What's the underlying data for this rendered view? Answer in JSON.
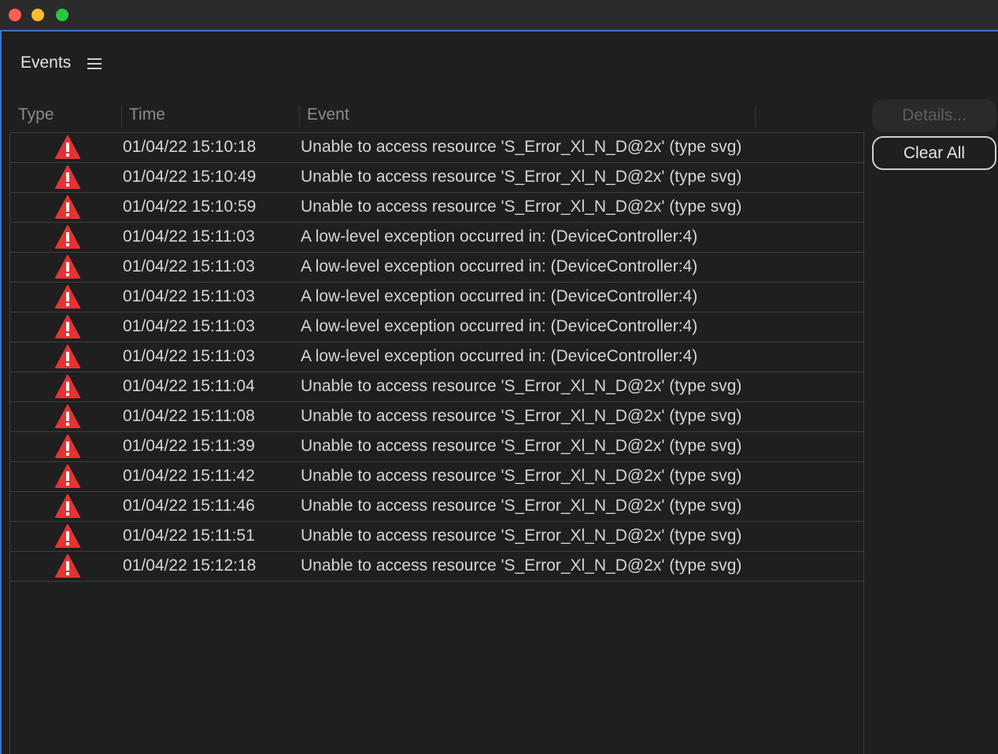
{
  "panel": {
    "title": "Events"
  },
  "columns": {
    "type": "Type",
    "time": "Time",
    "event": "Event"
  },
  "buttons": {
    "details": "Details...",
    "clear_all": "Clear All"
  },
  "colors": {
    "accent": "#3a79c9",
    "warning": "#e63232",
    "close": "#fe5f57",
    "minimize": "#febc2e",
    "maximize": "#28c840"
  },
  "rows": [
    {
      "type_icon": "warning-icon",
      "time": "01/04/22 15:10:18",
      "event": "Unable to access resource 'S_Error_Xl_N_D@2x' (type svg)"
    },
    {
      "type_icon": "warning-icon",
      "time": "01/04/22 15:10:49",
      "event": "Unable to access resource 'S_Error_Xl_N_D@2x' (type svg)"
    },
    {
      "type_icon": "warning-icon",
      "time": "01/04/22 15:10:59",
      "event": "Unable to access resource 'S_Error_Xl_N_D@2x' (type svg)"
    },
    {
      "type_icon": "warning-icon",
      "time": "01/04/22 15:11:03",
      "event": "A low-level exception occurred in:  (DeviceController:4)"
    },
    {
      "type_icon": "warning-icon",
      "time": "01/04/22 15:11:03",
      "event": "A low-level exception occurred in:  (DeviceController:4)"
    },
    {
      "type_icon": "warning-icon",
      "time": "01/04/22 15:11:03",
      "event": "A low-level exception occurred in:  (DeviceController:4)"
    },
    {
      "type_icon": "warning-icon",
      "time": "01/04/22 15:11:03",
      "event": "A low-level exception occurred in:  (DeviceController:4)"
    },
    {
      "type_icon": "warning-icon",
      "time": "01/04/22 15:11:03",
      "event": "A low-level exception occurred in:  (DeviceController:4)"
    },
    {
      "type_icon": "warning-icon",
      "time": "01/04/22 15:11:04",
      "event": "Unable to access resource 'S_Error_Xl_N_D@2x' (type svg)"
    },
    {
      "type_icon": "warning-icon",
      "time": "01/04/22 15:11:08",
      "event": "Unable to access resource 'S_Error_Xl_N_D@2x' (type svg)"
    },
    {
      "type_icon": "warning-icon",
      "time": "01/04/22 15:11:39",
      "event": "Unable to access resource 'S_Error_Xl_N_D@2x' (type svg)"
    },
    {
      "type_icon": "warning-icon",
      "time": "01/04/22 15:11:42",
      "event": "Unable to access resource 'S_Error_Xl_N_D@2x' (type svg)"
    },
    {
      "type_icon": "warning-icon",
      "time": "01/04/22 15:11:46",
      "event": "Unable to access resource 'S_Error_Xl_N_D@2x' (type svg)"
    },
    {
      "type_icon": "warning-icon",
      "time": "01/04/22 15:11:51",
      "event": "Unable to access resource 'S_Error_Xl_N_D@2x' (type svg)"
    },
    {
      "type_icon": "warning-icon",
      "time": "01/04/22 15:12:18",
      "event": "Unable to access resource 'S_Error_Xl_N_D@2x' (type svg)"
    }
  ]
}
